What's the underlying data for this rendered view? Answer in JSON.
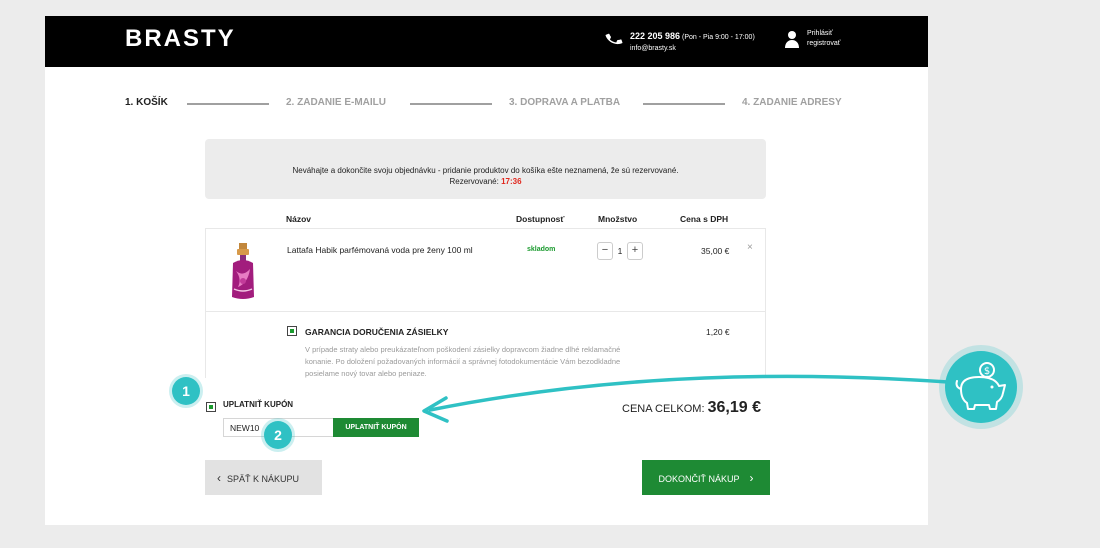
{
  "header": {
    "logo": "BRASTY",
    "phone_number": "222 205 986",
    "phone_hours": " (Pon - Pia 9:00 - 17:00)",
    "email": "info@brasty.sk",
    "login_line1": "Prihlásiť",
    "login_line2": "registrovať"
  },
  "steps": [
    {
      "label": "1. KOŠÍK"
    },
    {
      "label": "2. ZADANIE E-MAILU"
    },
    {
      "label": "3. DOPRAVA A PLATBA"
    },
    {
      "label": "4. ZADANIE ADRESY"
    }
  ],
  "notice": {
    "text": "Neváhajte a dokončite svoju objednávku - pridanie produktov do košíka ešte neznamená, že sú rezervované.",
    "reserved_label": "Rezervované: ",
    "reserved_time": "17:36"
  },
  "table": {
    "col_name": "Názov",
    "col_stock": "Dostupnosť",
    "col_qty": "Množstvo",
    "col_price": "Cena s DPH"
  },
  "product": {
    "name": "Lattafa Habik parfémovaná voda pre ženy 100 ml",
    "stock": "skladom",
    "qty": "1",
    "price": "35,00 €",
    "minus": "−",
    "plus": "+",
    "remove": "×"
  },
  "guarantee": {
    "title": "GARANCIA DORUČENIA ZÁSIELKY",
    "desc": "V prípade straty alebo preukázateľnom poškodení zásielky dopravcom žiadne dlhé reklamačné konanie. Po doložení požadovaných informácií a správnej fotodokumentácie Vám bezodkladne posielame nový tovar alebo peniaze.",
    "price": "1,20 €"
  },
  "coupon": {
    "label": "UPLATNIŤ KUPÓN",
    "value": "NEW10",
    "button": "UPLATNIŤ KUPÓN"
  },
  "total": {
    "label": "CENA CELKOM: ",
    "value": "36,19 €"
  },
  "buttons": {
    "back": "SPÄŤ K NÁKUPU",
    "finish": "DOKONČIŤ NÁKUP"
  },
  "badges": {
    "one": "1",
    "two": "2"
  },
  "colors": {
    "accent_green": "#1e8a34",
    "annotation_teal": "#2fc1c4",
    "timer_red": "#e0281e"
  }
}
